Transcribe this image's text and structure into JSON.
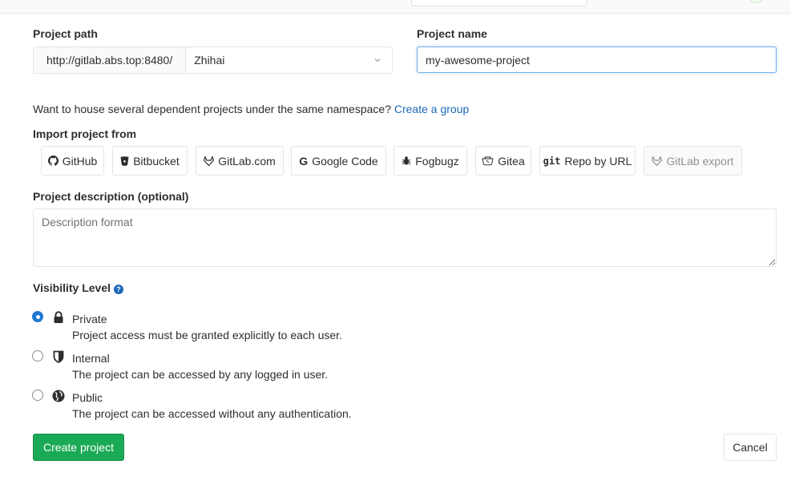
{
  "project_path": {
    "label": "Project path",
    "prefix": "http://gitlab.abs.top:8480/",
    "namespace": "Zhihai"
  },
  "project_name": {
    "label": "Project name",
    "value": "my-awesome-project"
  },
  "namespace_hint": {
    "text": "Want to house several dependent projects under the same namespace?",
    "link": "Create a group"
  },
  "import": {
    "label": "Import project from",
    "sources": [
      {
        "label": "GitHub",
        "icon": "github-icon"
      },
      {
        "label": "Bitbucket",
        "icon": "bitbucket-icon"
      },
      {
        "label": "GitLab.com",
        "icon": "gitlab-icon"
      },
      {
        "label": "Google Code",
        "icon": "google-icon"
      },
      {
        "label": "Fogbugz",
        "icon": "bug-icon"
      },
      {
        "label": "Gitea",
        "icon": "gitea-icon"
      },
      {
        "label": "Repo by URL",
        "icon": "git-icon",
        "icon_text": "git"
      },
      {
        "label": "GitLab export",
        "icon": "gitlab-icon",
        "disabled": true
      }
    ]
  },
  "description": {
    "label": "Project description (optional)",
    "placeholder": "Description format"
  },
  "visibility": {
    "label": "Visibility Level",
    "help_glyph": "?",
    "selected": "Private",
    "options": [
      {
        "title": "Private",
        "description": "Project access must be granted explicitly to each user.",
        "icon": "lock-icon"
      },
      {
        "title": "Internal",
        "description": "The project can be accessed by any logged in user.",
        "icon": "shield-icon"
      },
      {
        "title": "Public",
        "description": "The project can be accessed without any authentication.",
        "icon": "globe-icon"
      }
    ]
  },
  "actions": {
    "create": "Create project",
    "cancel": "Cancel"
  },
  "colors": {
    "primary_green": "#1aaa55",
    "link_blue": "#1b69b6",
    "radio_blue": "#1f78d1",
    "focus_border": "#73afea"
  }
}
